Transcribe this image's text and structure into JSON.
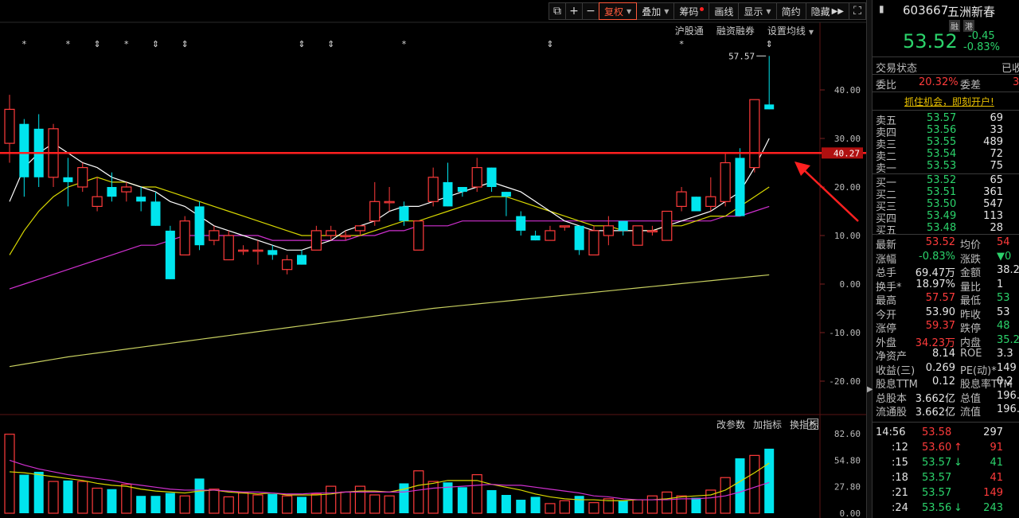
{
  "toolbar": {
    "buttons": [
      "复权",
      "叠加",
      "筹码",
      "画线",
      "显示",
      "简约",
      "隐藏"
    ],
    "sub_links": [
      "沪股通",
      "融资融券",
      "设置均线"
    ]
  },
  "chart": {
    "price_labels": [
      "40.00",
      "30.00",
      "20.00",
      "10.00",
      "0.00",
      "-10.00",
      "-20.00"
    ],
    "current_tag": "40.27",
    "high_label": "57.57",
    "vol_links": [
      "改参数",
      "加指标",
      "换指标"
    ],
    "vol_labels": [
      "82.60",
      "54.80",
      "27.80",
      "0.00"
    ],
    "candles": [
      {
        "o": 29,
        "c": 36,
        "h": 39,
        "l": 25
      },
      {
        "o": 33,
        "c": 22,
        "h": 34,
        "l": 18
      },
      {
        "o": 32,
        "c": 22,
        "h": 35,
        "l": 20
      },
      {
        "o": 22,
        "c": 32,
        "h": 33,
        "l": 20
      },
      {
        "o": 22,
        "c": 21,
        "h": 26,
        "l": 16
      },
      {
        "o": 20,
        "c": 24,
        "h": 25,
        "l": 19
      },
      {
        "o": 16,
        "c": 18,
        "h": 22,
        "l": 15
      },
      {
        "o": 20,
        "c": 18,
        "h": 23,
        "l": 17
      },
      {
        "o": 19,
        "c": 20,
        "h": 21,
        "l": 17
      },
      {
        "o": 18,
        "c": 17,
        "h": 20,
        "l": 15
      },
      {
        "o": 17,
        "c": 12,
        "h": 19,
        "l": 12
      },
      {
        "o": 11,
        "c": 1,
        "h": 12,
        "l": 1
      },
      {
        "o": 6,
        "c": 13,
        "h": 14,
        "l": 6
      },
      {
        "o": 16,
        "c": 8,
        "h": 17,
        "l": 7
      },
      {
        "o": 9,
        "c": 11,
        "h": 12,
        "l": 8
      },
      {
        "o": 5,
        "c": 10,
        "h": 11,
        "l": 5
      },
      {
        "o": 7,
        "c": 7,
        "h": 8,
        "l": 6
      },
      {
        "o": 7,
        "c": 7,
        "h": 9,
        "l": 4
      },
      {
        "o": 7,
        "c": 6,
        "h": 8,
        "l": 5
      },
      {
        "o": 3,
        "c": 5,
        "h": 6,
        "l": 2
      },
      {
        "o": 6,
        "c": 4,
        "h": 7,
        "l": 4
      },
      {
        "o": 7,
        "c": 11,
        "h": 12,
        "l": 7
      },
      {
        "o": 10,
        "c": 11,
        "h": 12,
        "l": 9
      },
      {
        "o": 10,
        "c": 10,
        "h": 11,
        "l": 9
      },
      {
        "o": 11,
        "c": 12,
        "h": 12,
        "l": 10
      },
      {
        "o": 13,
        "c": 17,
        "h": 21,
        "l": 12
      },
      {
        "o": 17,
        "c": 17,
        "h": 20,
        "l": 15
      },
      {
        "o": 16,
        "c": 13,
        "h": 17,
        "l": 12
      },
      {
        "o": 7,
        "c": 13,
        "h": 13,
        "l": 7
      },
      {
        "o": 17,
        "c": 22,
        "h": 24,
        "l": 16
      },
      {
        "o": 21,
        "c": 16,
        "h": 25,
        "l": 16
      },
      {
        "o": 20,
        "c": 19,
        "h": 20,
        "l": 18
      },
      {
        "o": 20,
        "c": 24,
        "h": 26,
        "l": 19
      },
      {
        "o": 24,
        "c": 20,
        "h": 24,
        "l": 19
      },
      {
        "o": 19,
        "c": 18,
        "h": 19,
        "l": 14
      },
      {
        "o": 14,
        "c": 11,
        "h": 15,
        "l": 10
      },
      {
        "o": 10,
        "c": 9,
        "h": 11,
        "l": 9
      },
      {
        "o": 9,
        "c": 11,
        "h": 12,
        "l": 9
      },
      {
        "o": 12,
        "c": 12,
        "h": 12,
        "l": 11
      },
      {
        "o": 12,
        "c": 7,
        "h": 12,
        "l": 6
      },
      {
        "o": 6,
        "c": 11,
        "h": 12,
        "l": 6
      },
      {
        "o": 10,
        "c": 12,
        "h": 14,
        "l": 8
      },
      {
        "o": 13,
        "c": 11,
        "h": 13,
        "l": 10
      },
      {
        "o": 8,
        "c": 12,
        "h": 12,
        "l": 8
      },
      {
        "o": 11,
        "c": 11,
        "h": 12,
        "l": 10
      },
      {
        "o": 9,
        "c": 15,
        "h": 15,
        "l": 9
      },
      {
        "o": 16,
        "c": 19,
        "h": 20,
        "l": 15
      },
      {
        "o": 18,
        "c": 15,
        "h": 18,
        "l": 15
      },
      {
        "o": 16,
        "c": 18,
        "h": 22,
        "l": 15
      },
      {
        "o": 17,
        "c": 25,
        "h": 27,
        "l": 16
      },
      {
        "o": 26,
        "c": 14,
        "h": 28,
        "l": 14
      },
      {
        "o": 24,
        "c": 38,
        "h": 38,
        "l": 23
      },
      {
        "o": 37,
        "c": 36,
        "h": 47,
        "l": 36
      }
    ],
    "ma5": [
      17,
      24,
      27,
      29,
      27,
      25,
      24,
      22,
      21,
      20,
      19,
      17,
      16,
      14,
      12,
      11,
      10,
      9,
      8,
      7,
      7,
      8,
      9,
      11,
      12,
      13,
      15,
      16,
      16,
      17,
      18,
      19,
      20,
      21,
      20,
      19,
      17,
      15,
      13,
      12,
      11,
      11,
      11,
      11,
      11,
      12,
      13,
      14,
      15,
      17,
      19,
      24,
      30
    ],
    "ma10": [
      6,
      11,
      15,
      18,
      20,
      21,
      22,
      21,
      21,
      20,
      20,
      19,
      18,
      17,
      16,
      15,
      14,
      13,
      12,
      11,
      10,
      10,
      10,
      10,
      10,
      11,
      12,
      13,
      13,
      14,
      15,
      16,
      17,
      18,
      18,
      17,
      16,
      15,
      14,
      13,
      12,
      12,
      11,
      11,
      11,
      12,
      12,
      13,
      14,
      14,
      16,
      18,
      20
    ],
    "ma20": [
      -1,
      0,
      1,
      2,
      3,
      4,
      5,
      6,
      7,
      8,
      8,
      9,
      10,
      10,
      10,
      10,
      10,
      10,
      9,
      9,
      9,
      9,
      9,
      9,
      10,
      10,
      11,
      11,
      12,
      12,
      12,
      13,
      13,
      13,
      13,
      13,
      13,
      13,
      13,
      13,
      13,
      13,
      13,
      13,
      13,
      13,
      13,
      13,
      13,
      14,
      14,
      15,
      16
    ],
    "ma60": [
      -17,
      -16.5,
      -16,
      -15.5,
      -15,
      -14.6,
      -14.2,
      -13.8,
      -13.4,
      -13,
      -12.6,
      -12.2,
      -11.8,
      -11.4,
      -11,
      -10.6,
      -10.2,
      -9.8,
      -9.4,
      -9,
      -8.6,
      -8.2,
      -7.8,
      -7.4,
      -7,
      -6.6,
      -6.2,
      -5.8,
      -5.4,
      -5,
      -4.7,
      -4.4,
      -4.1,
      -3.8,
      -3.5,
      -3.2,
      -2.9,
      -2.6,
      -2.3,
      -2,
      -1.7,
      -1.4,
      -1.1,
      -0.8,
      -0.5,
      -0.2,
      0.1,
      0.4,
      0.7,
      1,
      1.3,
      1.6,
      1.9
    ],
    "volumes": [
      82,
      40,
      43,
      33,
      34,
      33,
      26,
      25,
      30,
      18,
      18,
      21,
      18,
      36,
      25,
      17,
      21,
      19,
      20,
      18,
      17,
      20,
      28,
      22,
      28,
      19,
      18,
      31,
      44,
      33,
      32,
      27,
      40,
      24,
      19,
      14,
      17,
      10,
      13,
      18,
      11,
      15,
      13,
      14,
      18,
      22,
      18,
      16,
      24,
      37,
      57,
      60,
      67
    ],
    "vol_ma5": [
      43,
      42,
      40,
      38,
      36,
      34,
      31,
      29,
      28,
      25,
      23,
      22,
      21,
      23,
      24,
      22,
      21,
      20,
      21,
      19,
      19,
      19,
      20,
      22,
      23,
      23,
      22,
      25,
      29,
      31,
      34,
      34,
      34,
      30,
      27,
      24,
      20,
      17,
      15,
      14,
      14,
      13,
      13,
      14,
      14,
      15,
      17,
      18,
      19,
      24,
      33,
      42,
      52
    ],
    "vol_ma10": [
      55,
      50,
      46,
      43,
      40,
      38,
      36,
      34,
      31,
      29,
      27,
      25,
      24,
      24,
      24,
      23,
      22,
      22,
      21,
      20,
      20,
      21,
      21,
      22,
      22,
      22,
      22,
      22,
      24,
      26,
      27,
      28,
      29,
      30,
      29,
      29,
      27,
      25,
      23,
      21,
      18,
      17,
      15,
      14,
      14,
      14,
      15,
      15,
      16,
      18,
      22,
      27,
      32
    ],
    "markers": [
      {
        "i": 1,
        "s": "*"
      },
      {
        "i": 4,
        "s": "*"
      },
      {
        "i": 6,
        "s": "⇕"
      },
      {
        "i": 8,
        "s": "*"
      },
      {
        "i": 10,
        "s": "⇕"
      },
      {
        "i": 12,
        "s": "⇕"
      },
      {
        "i": 20,
        "s": "⇕"
      },
      {
        "i": 22,
        "s": "⇕"
      },
      {
        "i": 27,
        "s": "*"
      },
      {
        "i": 37,
        "s": "⇕"
      },
      {
        "i": 46,
        "s": "*"
      },
      {
        "i": 52,
        "s": "⇕"
      }
    ]
  },
  "quote": {
    "code": "603667",
    "name": "五洲新春",
    "badges": [
      "融",
      "港"
    ],
    "price": "53.52",
    "change": "-0.45",
    "change_pct": "-0.83%",
    "status_label": "交易状态",
    "status_value": "已收",
    "weibi_label": "委比",
    "weibi_value": "20.32%",
    "weicha_label": "委差",
    "weicha_value": "3",
    "promo": "抓住机会，即刻开户!",
    "asks": [
      {
        "label": "卖五",
        "price": "53.57",
        "vol": "69"
      },
      {
        "label": "卖四",
        "price": "53.56",
        "vol": "33"
      },
      {
        "label": "卖三",
        "price": "53.55",
        "vol": "489"
      },
      {
        "label": "卖二",
        "price": "53.54",
        "vol": "72"
      },
      {
        "label": "卖一",
        "price": "53.53",
        "vol": "75"
      }
    ],
    "bids": [
      {
        "label": "买一",
        "price": "53.52",
        "vol": "65"
      },
      {
        "label": "买二",
        "price": "53.51",
        "vol": "361"
      },
      {
        "label": "买三",
        "price": "53.50",
        "vol": "547"
      },
      {
        "label": "买四",
        "price": "53.49",
        "vol": "113"
      },
      {
        "label": "买五",
        "price": "53.48",
        "vol": "28"
      }
    ],
    "stats": [
      {
        "l1": "最新",
        "v1": "53.52",
        "c1": "red",
        "l2": "均价",
        "v2": "54",
        "c2": "red"
      },
      {
        "l1": "涨幅",
        "v1": "-0.83%",
        "c1": "green",
        "l2": "涨跌",
        "v2": "▼0",
        "c2": "green"
      },
      {
        "l1": "总手",
        "v1": "69.47万",
        "c1": "white",
        "l2": "金额",
        "v2": "38.2",
        "c2": "white"
      },
      {
        "l1": "换手*",
        "v1": "18.97%",
        "c1": "white",
        "l2": "量比",
        "v2": "1",
        "c2": "white"
      },
      {
        "l1": "最高",
        "v1": "57.57",
        "c1": "red",
        "l2": "最低",
        "v2": "53",
        "c2": "green"
      },
      {
        "l1": "今开",
        "v1": "53.90",
        "c1": "white",
        "l2": "昨收",
        "v2": "53",
        "c2": "white"
      },
      {
        "l1": "涨停",
        "v1": "59.37",
        "c1": "red",
        "l2": "跌停",
        "v2": "48",
        "c2": "green"
      },
      {
        "l1": "外盘",
        "v1": "34.23万",
        "c1": "red",
        "l2": "内盘",
        "v2": "35.2",
        "c2": "green"
      },
      {
        "l1": "净资产",
        "v1": "8.14",
        "c1": "white",
        "l2": "ROE",
        "v2": "3.3",
        "c2": "white"
      },
      {
        "l1": "收益(三)",
        "v1": "0.269",
        "c1": "white",
        "l2": "PE(动)*",
        "v2": "149",
        "c2": "white"
      },
      {
        "l1": "股息TTM",
        "v1": "0.12",
        "c1": "white",
        "l2": "股息率TTM",
        "v2": "0.2",
        "c2": "white"
      },
      {
        "l1": "总股本",
        "v1": "3.662亿",
        "c1": "white",
        "l2": "总值",
        "v2": "196.",
        "c2": "white"
      },
      {
        "l1": "流通股",
        "v1": "3.662亿",
        "c1": "white",
        "l2": "流值",
        "v2": "196.",
        "c2": "white"
      }
    ],
    "ticks": [
      {
        "t": "14:56",
        "p": "53.58",
        "v": "297",
        "pc": "red",
        "vc": "white",
        "a": ""
      },
      {
        "t": ":12",
        "p": "53.60",
        "v": "91",
        "pc": "red",
        "vc": "red",
        "a": "↑"
      },
      {
        "t": ":15",
        "p": "53.57",
        "v": "41",
        "pc": "green",
        "vc": "green",
        "a": "↓"
      },
      {
        "t": ":18",
        "p": "53.57",
        "v": "41",
        "pc": "green",
        "vc": "red",
        "a": ""
      },
      {
        "t": ":21",
        "p": "53.57",
        "v": "149",
        "pc": "green",
        "vc": "red",
        "a": ""
      },
      {
        "t": ":24",
        "p": "53.56",
        "v": "243",
        "pc": "green",
        "vc": "green",
        "a": "↓"
      }
    ]
  }
}
